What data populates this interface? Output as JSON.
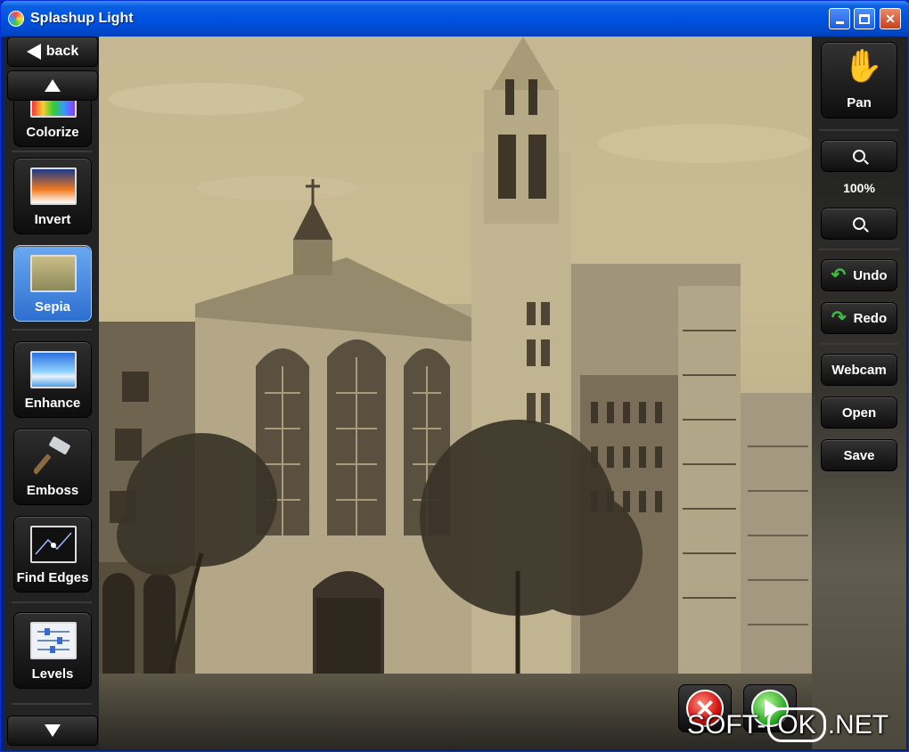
{
  "window": {
    "title": "Splashup Light"
  },
  "left_toolbar": {
    "back_label": "back",
    "tools": [
      {
        "label": "Colorize",
        "icon": "colorize-icon",
        "active": false
      },
      {
        "label": "Invert",
        "icon": "invert-icon",
        "active": false
      },
      {
        "label": "Sepia",
        "icon": "sepia-icon",
        "active": true
      },
      {
        "label": "Enhance",
        "icon": "enhance-icon",
        "active": false
      },
      {
        "label": "Emboss",
        "icon": "hammer-icon",
        "active": false
      },
      {
        "label": "Find Edges",
        "icon": "find-edges-icon",
        "active": false
      },
      {
        "label": "Levels",
        "icon": "levels-icon",
        "active": false
      }
    ]
  },
  "right_toolbar": {
    "pan_label": "Pan",
    "zoom_level": "100%",
    "undo_label": "Undo",
    "redo_label": "Redo",
    "webcam_label": "Webcam",
    "open_label": "Open",
    "save_label": "Save"
  },
  "canvas": {
    "filter_applied": "Sepia"
  },
  "watermark": {
    "part1": "SOFT-",
    "part2": "OK",
    "part3": ".NET"
  },
  "colors": {
    "titlebar": "#0053e0",
    "active_tool": "#4a8ee8",
    "toolbar_bg": "#232323",
    "sepia": "#c5b791"
  }
}
